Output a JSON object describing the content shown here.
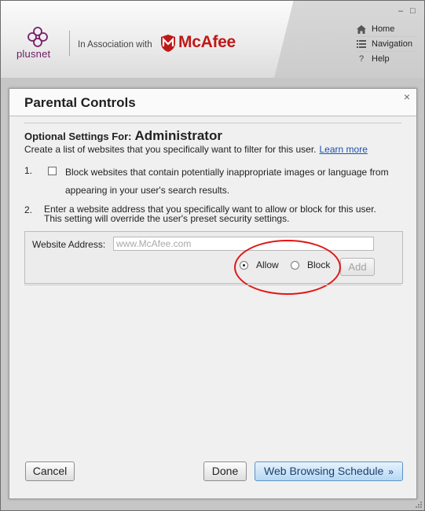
{
  "header": {
    "brand": "plusnet",
    "association": "In Association with",
    "partner": "McAfee",
    "window_controls": [
      "–",
      "□"
    ],
    "nav": [
      {
        "label": "Home",
        "icon": "home-icon"
      },
      {
        "label": "Navigation",
        "icon": "list-icon"
      },
      {
        "label": "Help",
        "icon": "help-icon"
      }
    ]
  },
  "dialog": {
    "title": "Parental Controls",
    "close": "×",
    "heading_prefix": "Optional Settings For:",
    "user": "Administrator",
    "description": "Create a list of websites that you specifically want to filter for this user.",
    "learn_more": "Learn more",
    "item1_number": "1.",
    "item1_text": "Block websites that contain potentially inappropriate images or language from appearing in your user's search results.",
    "item1_checked": false,
    "item2_number": "2.",
    "item2_line1": "Enter a website address that you specifically want to allow or block for this user.",
    "item2_line2": "This setting will override the user's preset security settings.",
    "address_label": "Website Address:",
    "address_placeholder": "www.McAfee.com",
    "address_value": "",
    "radio_allow": "Allow",
    "radio_block": "Block",
    "selected_radio": "Allow",
    "add_label": "Add",
    "cancel_label": "Cancel",
    "done_label": "Done",
    "schedule_label": "Web Browsing Schedule",
    "schedule_chevron": "»"
  },
  "colors": {
    "accent": "#c01818",
    "link": "#1a4fb0",
    "annotation": "#e41515",
    "primary_button": "#b6d8f3"
  }
}
